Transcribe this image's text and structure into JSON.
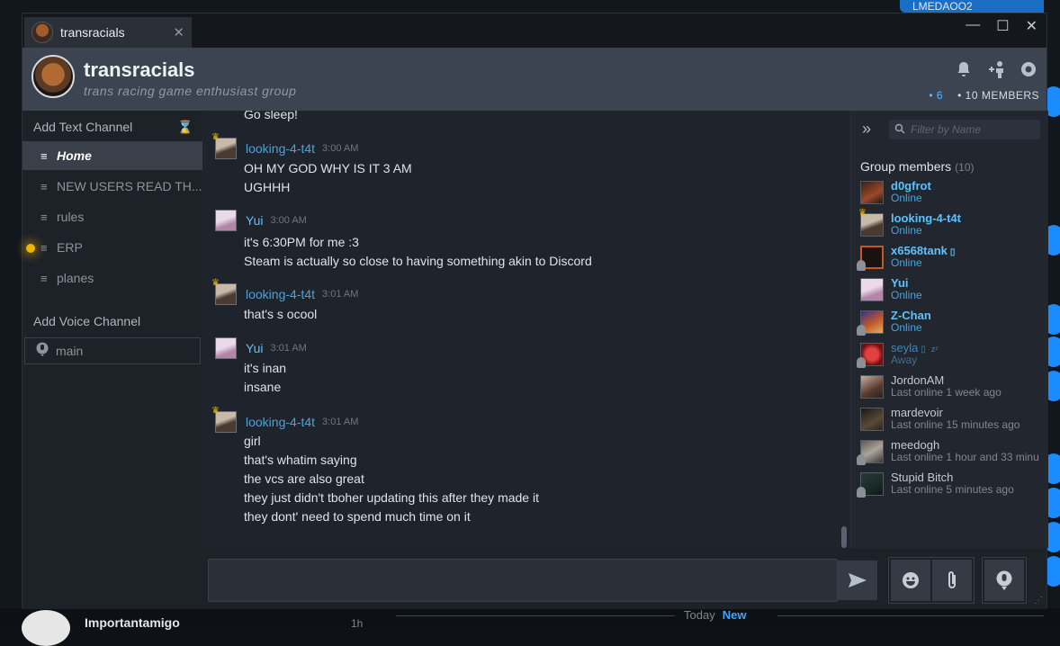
{
  "background": {
    "topright_text": "LMEDAOO2",
    "bottom_user": "Importantamigo",
    "bottom_time": "1h",
    "today_label": "Today",
    "new_label": "New"
  },
  "tab": {
    "title": "transracials",
    "close": "✕"
  },
  "window_controls": {
    "minimize": "—",
    "maximize": "☐",
    "close": "✕"
  },
  "group": {
    "name": "transracials",
    "tagline": "trans racing game enthusiast group",
    "online": "• 6",
    "members": "• 10 MEMBERS"
  },
  "header_icons": [
    "bell-icon",
    "add-friend-icon",
    "settings-icon"
  ],
  "sidebar": {
    "text_heading": "Add Text Channel",
    "voice_heading": "Add Voice Channel",
    "channels": [
      {
        "label": "Home",
        "active": true
      },
      {
        "label": "NEW USERS READ TH...",
        "active": false
      },
      {
        "label": "rules",
        "active": false
      },
      {
        "label": "ERP",
        "active": false
      },
      {
        "label": "planes",
        "active": false
      }
    ],
    "voice_channels": [
      {
        "label": "main"
      }
    ]
  },
  "chat": {
    "top_line": "Go sleep!",
    "messages": [
      {
        "author": "looking-4-t4t",
        "time": "3:00 AM",
        "lines": [
          "OH MY GOD WHY IS IT 3 AM",
          "UGHHH"
        ]
      },
      {
        "author": "Yui",
        "time": "3:00 AM",
        "lines": [
          "it's 6:30PM for me :3",
          "Steam is actually so close to having something akin to Discord"
        ]
      },
      {
        "author": "looking-4-t4t",
        "time": "3:01 AM",
        "lines": [
          "that's s ocool"
        ]
      },
      {
        "author": "Yui",
        "time": "3:01 AM",
        "lines": [
          "it's inan",
          "insane"
        ]
      },
      {
        "author": "looking-4-t4t",
        "time": "3:01 AM",
        "lines": [
          "girl",
          "that's whatim saying",
          "the vcs are also great",
          "they just didn't tboher updating this after they made it",
          "they dont' need to spend much time on it"
        ]
      }
    ]
  },
  "members_panel": {
    "filter_placeholder": "Filter by Name",
    "title": "Group members",
    "count": "(10)",
    "members": [
      {
        "name": "d0gfrot",
        "status": "Online"
      },
      {
        "name": "looking-4-t4t",
        "status": "Online"
      },
      {
        "name": "x6568tank",
        "status": "Online"
      },
      {
        "name": "Yui",
        "status": "Online"
      },
      {
        "name": "Z-Chan",
        "status": "Online"
      },
      {
        "name": "seyla",
        "status": "Away"
      },
      {
        "name": "JordonAM",
        "status": "Last online 1 week ago"
      },
      {
        "name": "mardevoir",
        "status": "Last online 15 minutes ago"
      },
      {
        "name": "meedogh",
        "status": "Last online 1 hour and 33 minu"
      },
      {
        "name": "Stupid Bitch",
        "status": "Last online 5 minutes ago"
      }
    ]
  },
  "composer": {
    "input_value": "",
    "send_icon": "send-icon",
    "emoji_icon": "emoji-icon",
    "attach_icon": "paperclip-icon",
    "voice_icon": "voice-icon"
  },
  "colors": {
    "accent": "#5cc1ff",
    "author_link": "#4aa3d8",
    "header_bg": "#3c4451",
    "crown": "#e8b100"
  }
}
